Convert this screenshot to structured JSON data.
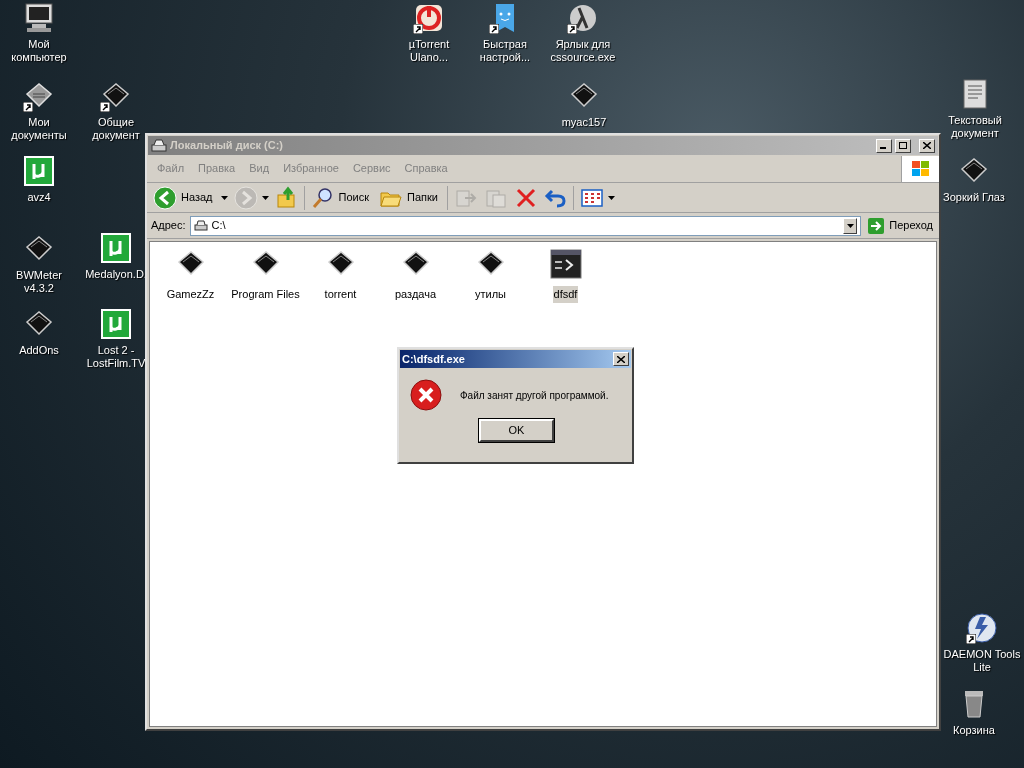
{
  "desktop_icons": [
    {
      "label": "Мой компьютер",
      "kind": "computer",
      "shortcut": false
    },
    {
      "label": "µTorrent Ulano...",
      "kind": "red-app",
      "shortcut": true
    },
    {
      "label": "Быстрая настрой...",
      "kind": "blue-app",
      "shortcut": true
    },
    {
      "label": "Ярлык для cssource.exe",
      "kind": "round-app",
      "shortcut": true
    },
    {
      "label": "Мои документы",
      "kind": "documents",
      "shortcut": true
    },
    {
      "label": "Общие документ",
      "kind": "folder",
      "shortcut": true
    },
    {
      "label": "myac157",
      "kind": "folder",
      "shortcut": false
    },
    {
      "label": "Текстовый документ",
      "kind": "text-document",
      "shortcut": false
    },
    {
      "label": "avz4",
      "kind": "torrent",
      "shortcut": false
    },
    {
      "label": "Зоркий Глаз",
      "kind": "folder",
      "shortcut": false
    },
    {
      "label": "BWMeter v4.3.2",
      "kind": "folder",
      "shortcut": false
    },
    {
      "label": "Medalyon.D.",
      "kind": "torrent",
      "shortcut": false
    },
    {
      "label": "AddOns",
      "kind": "folder",
      "shortcut": false
    },
    {
      "label": "Lost 2 - LostFilm.TV",
      "kind": "torrent",
      "shortcut": false
    },
    {
      "label": "DAEMON Tools Lite",
      "kind": "daemon",
      "shortcut": true
    },
    {
      "label": "Корзина",
      "kind": "trash",
      "shortcut": false
    }
  ],
  "explorer": {
    "title": "Локальный диск (C:)",
    "active": false,
    "menu": [
      "Файл",
      "Правка",
      "Вид",
      "Избранное",
      "Сервис",
      "Справка"
    ],
    "toolbar": [
      {
        "kind": "back",
        "label": "Назад",
        "disabled": false
      },
      {
        "kind": "forward",
        "disabled": true
      },
      {
        "kind": "up",
        "disabled": false
      },
      {
        "kind": "search",
        "label": "Поиск",
        "disabled": false
      },
      {
        "kind": "folders",
        "label": "Папки",
        "disabled": false
      },
      {
        "kind": "move",
        "disabled": true
      },
      {
        "kind": "copy",
        "disabled": true
      },
      {
        "kind": "delete",
        "disabled": false
      },
      {
        "kind": "undo",
        "disabled": false
      },
      {
        "kind": "views",
        "disabled": false
      }
    ],
    "address": {
      "label": "Адрес:",
      "value": "C:\\",
      "go": "Переход"
    },
    "files": [
      {
        "name": "GamezZz",
        "kind": "folder",
        "selected": false
      },
      {
        "name": "Program Files",
        "kind": "folder",
        "selected": false
      },
      {
        "name": "torrent",
        "kind": "folder",
        "selected": false
      },
      {
        "name": "раздача",
        "kind": "folder",
        "selected": false
      },
      {
        "name": "утилы",
        "kind": "folder",
        "selected": false
      },
      {
        "name": "dfsdf",
        "kind": "console",
        "selected": true
      }
    ]
  },
  "dialog": {
    "title": "C:\\dfsdf.exe",
    "message": "Файл занят другой программой.",
    "button": "OK"
  }
}
